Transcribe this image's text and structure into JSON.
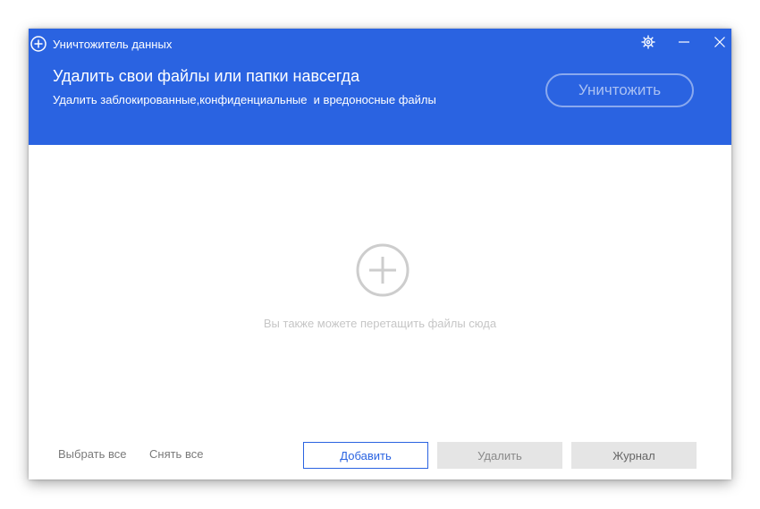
{
  "window": {
    "title": "Уничтожитель данных"
  },
  "header": {
    "headline": "Удалить свои файлы или папки навсегда",
    "subline": "Удалить заблокированные,конфиденциальные  и вредоносные файлы",
    "destroy_label": "Уничтожить",
    "accent_color": "#2a63e1"
  },
  "drop_area": {
    "hint": "Вы также можете перетащить файлы сюда",
    "icon": "add-circle-icon"
  },
  "footer": {
    "select_all": "Выбрать все",
    "deselect_all": "Снять все",
    "add_label": "Добавить",
    "delete_label": "Удалить",
    "log_label": "Журнал"
  },
  "icons": {
    "app": "add-circle-icon",
    "settings": "gear-icon",
    "minimize": "minimize-icon",
    "close": "close-icon"
  }
}
